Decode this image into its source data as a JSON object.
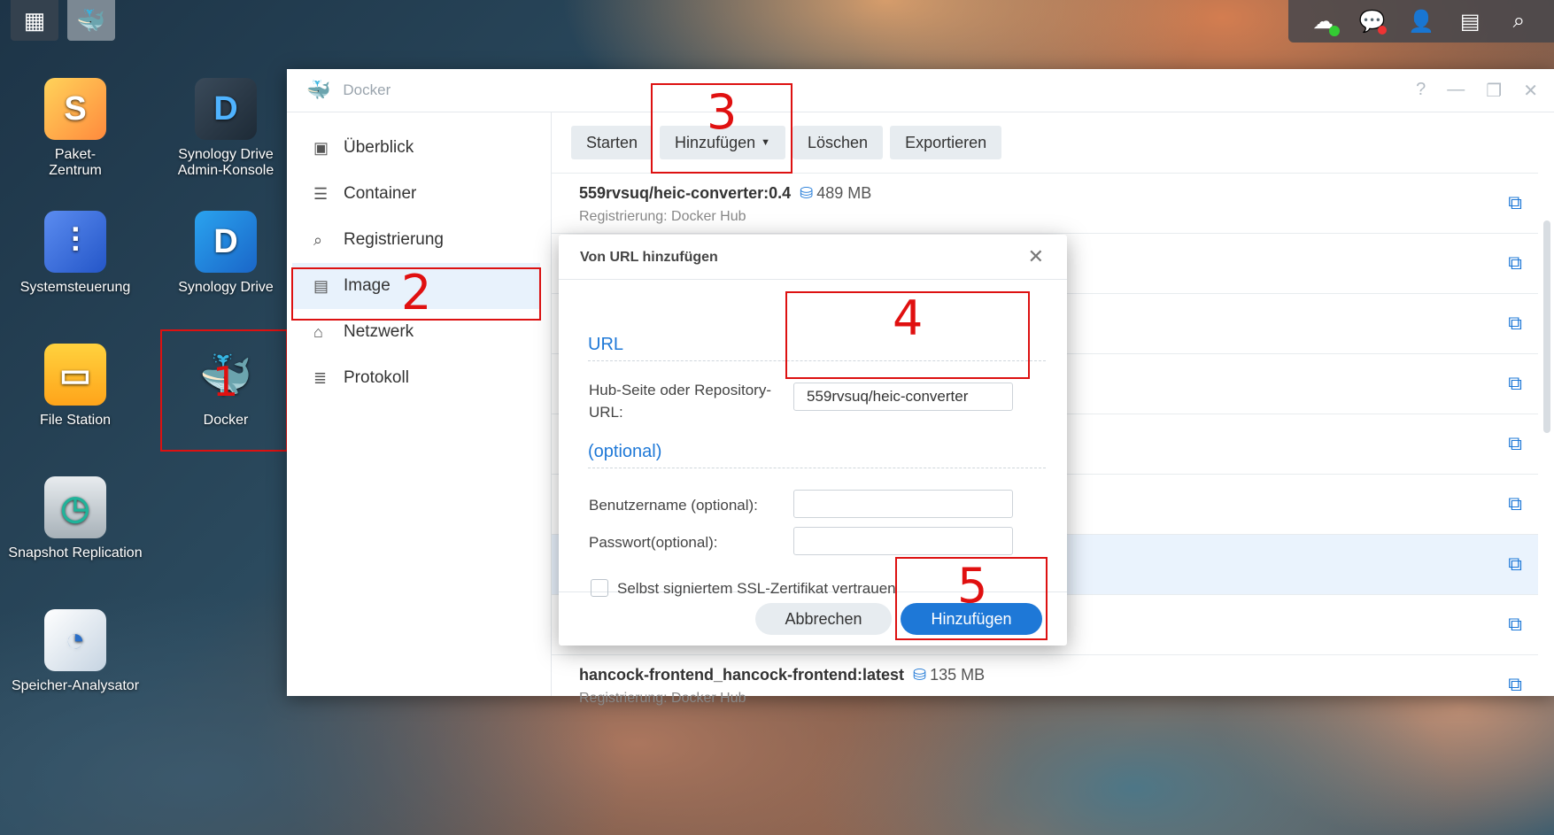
{
  "window": {
    "title": "Docker",
    "help": "?",
    "minimize": "—",
    "maximize": "❐",
    "close": "✕"
  },
  "desktop": {
    "icons": [
      {
        "label": "Paket-\nZentrum"
      },
      {
        "label": "Synology Drive\nAdmin-Konsole"
      },
      {
        "label": "Systemsteuerung"
      },
      {
        "label": "Synology Drive"
      },
      {
        "label": "File Station"
      },
      {
        "label": "Docker"
      },
      {
        "label": "Snapshot Replication"
      },
      {
        "label": "Speicher-Analysator"
      }
    ]
  },
  "annotations": {
    "a1": "1",
    "a2": "2",
    "a3": "3",
    "a4": "4",
    "a5": "5"
  },
  "sidebar": {
    "items": [
      {
        "label": "Überblick"
      },
      {
        "label": "Container"
      },
      {
        "label": "Registrierung"
      },
      {
        "label": "Image"
      },
      {
        "label": "Netzwerk"
      },
      {
        "label": "Protokoll"
      }
    ]
  },
  "toolbar": {
    "start": "Starten",
    "add": "Hinzufügen",
    "delete": "Löschen",
    "export": "Exportieren"
  },
  "images": [
    {
      "name": "559rvsuq/heic-converter:0.4",
      "size": "489 MB",
      "registry": "Registrierung: Docker Hub"
    },
    {
      "name": "hancock-frontend_hancock-frontend:latest",
      "size": "135 MB",
      "registry": "Registrierung: Docker Hub"
    }
  ],
  "dialog": {
    "title": "Von URL hinzufügen",
    "close": "✕",
    "section_url": "URL",
    "url_label": "Hub-Seite oder Repository-URL:",
    "url_value": "559rvsuq/heic-converter",
    "section_optional": "(optional)",
    "username_label": "Benutzername (optional):",
    "username_value": "",
    "password_label": "Passwort(optional):",
    "password_value": "",
    "ssl_label": "Selbst signiertem SSL-Zertifikat vertrauen",
    "ssl_checked": false,
    "cancel": "Abbrechen",
    "submit": "Hinzufügen"
  }
}
